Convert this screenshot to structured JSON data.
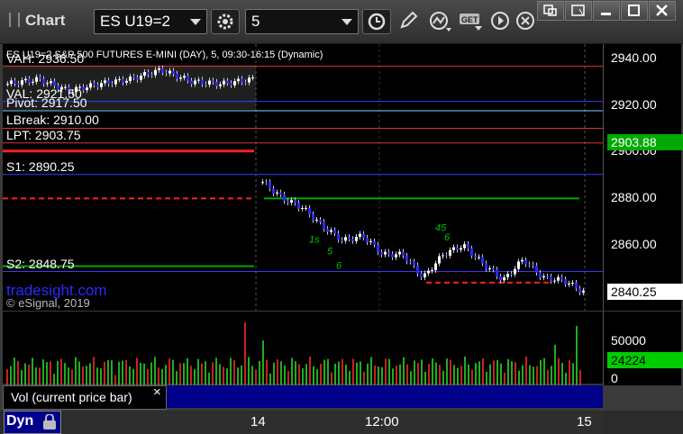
{
  "toolbar": {
    "title": "Chart",
    "symbol": "ES U19=2",
    "interval": "5"
  },
  "chart_data": {
    "type": "candlestick",
    "title": "ES U19=2 S&P 500 FUTURES E-MINI (DAY), 5, 09:30-16:15 (Dynamic)",
    "y_ticks": [
      "2940.00",
      "2920.00",
      "2900.00",
      "2880.00",
      "2860.00",
      "2840.00"
    ],
    "ylim": [
      2832,
      2946
    ],
    "x_ticks": [
      "14",
      "12:00",
      "15"
    ],
    "price_tags": [
      {
        "label": "2903.88",
        "value": 2903.88,
        "color": "#00aa00"
      },
      {
        "label": "2840.25",
        "value": 2840.25,
        "color": "#ffffff"
      }
    ],
    "levels": [
      {
        "label": "VAH: 2936.50",
        "value": 2936.5,
        "color": "#e03030"
      },
      {
        "label": "VAL: 2921.50",
        "value": 2921.5,
        "color": "#3a3aff"
      },
      {
        "label": "Pivot: 2917.50",
        "value": 2917.5,
        "color": "#80d0ff"
      },
      {
        "label": "LBreak: 2910.00",
        "value": 2910.0,
        "color": "#e03030"
      },
      {
        "label": "LPT: 2903.75",
        "value": 2903.75,
        "color": "#e03030"
      },
      {
        "label": "S1: 2890.25",
        "value": 2890.25,
        "color": "#3a3aff"
      },
      {
        "label": "S2: 2848.75",
        "value": 2848.75,
        "color": "#3a3aff"
      }
    ],
    "annotations": [
      "tradesight.com",
      "© eSignal, 2019"
    ],
    "volume": {
      "label": "Vol (current price bar)",
      "y_ticks": [
        "50000",
        "0"
      ],
      "tag": "24224"
    }
  },
  "bottom": {
    "dyn_label": "Dyn"
  }
}
